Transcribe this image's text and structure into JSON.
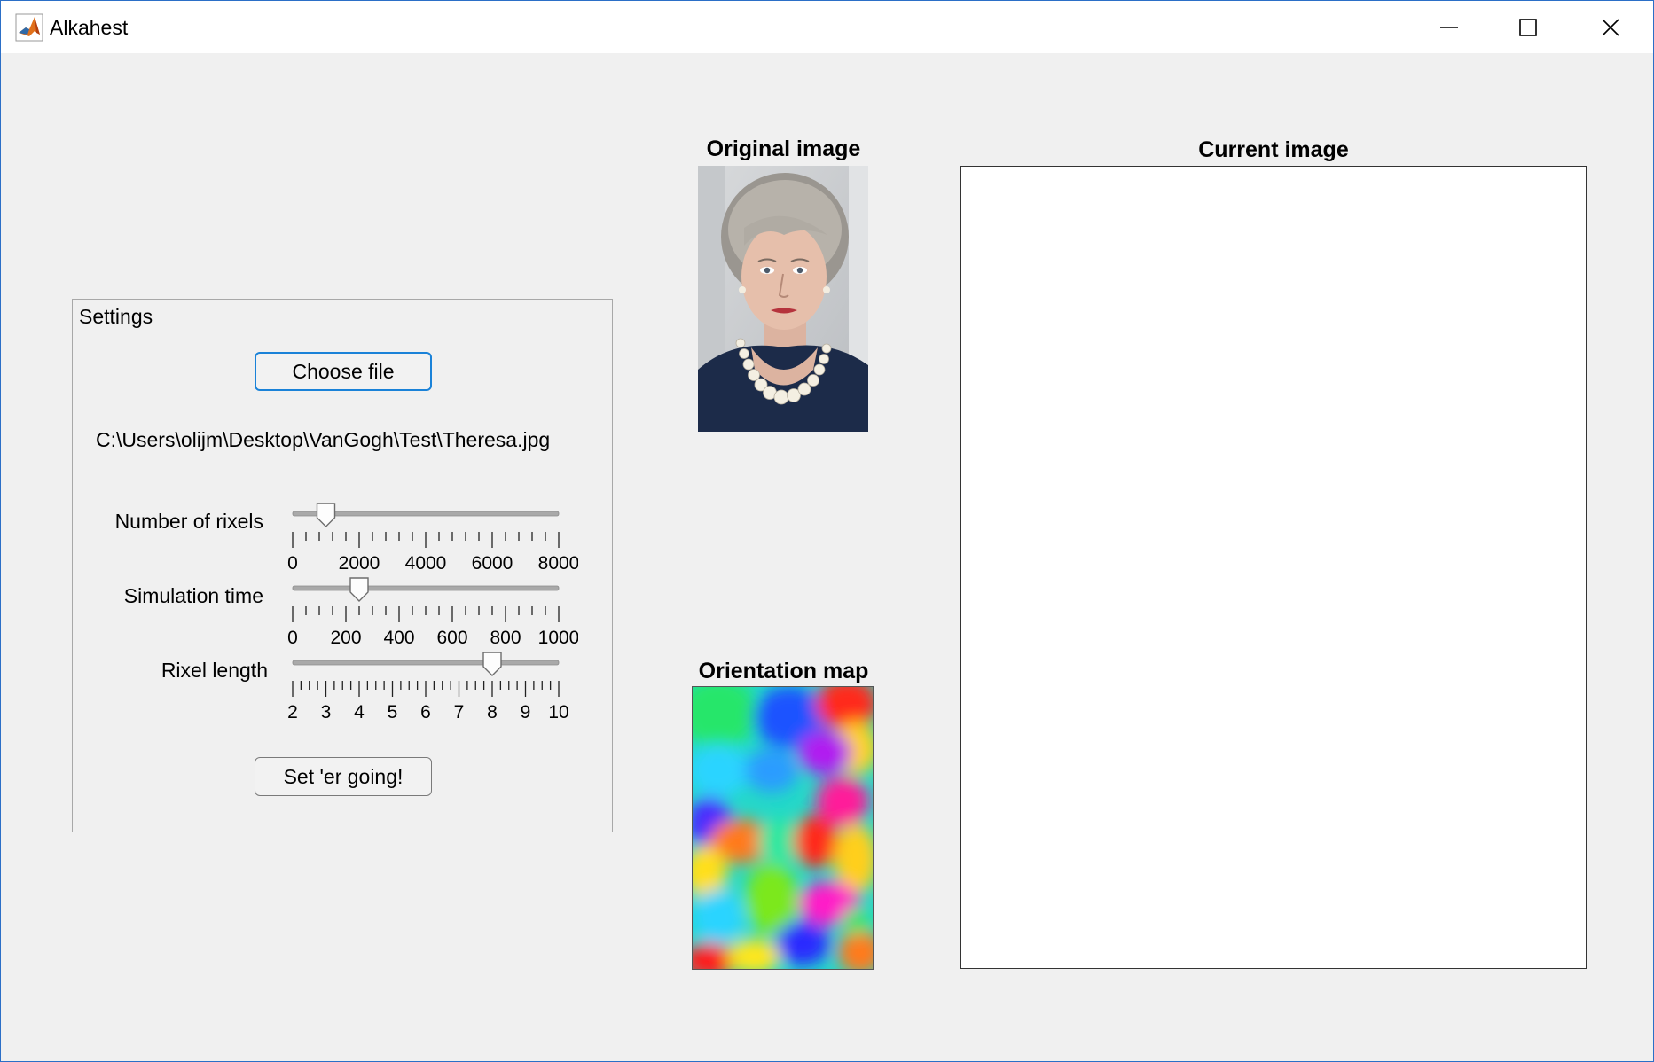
{
  "window": {
    "title": "Alkahest",
    "controls": [
      "minimize",
      "maximize",
      "close"
    ]
  },
  "settings": {
    "title": "Settings",
    "choose_file_label": "Choose file",
    "file_path": "C:\\Users\\olijm\\Desktop\\VanGogh\\Test\\Theresa.jpg",
    "run_label": "Set 'er going!",
    "sliders": [
      {
        "label": "Number of rixels",
        "min": 0,
        "max": 8000,
        "value": 1000,
        "tick_labels": [
          "0",
          "2000",
          "4000",
          "6000",
          "8000"
        ]
      },
      {
        "label": "Simulation time",
        "min": 0,
        "max": 1000,
        "value": 250,
        "tick_labels": [
          "0",
          "200",
          "400",
          "600",
          "800",
          "1000"
        ]
      },
      {
        "label": "Rixel length",
        "min": 2,
        "max": 10,
        "value": 8,
        "tick_labels": [
          "2",
          "3",
          "4",
          "5",
          "6",
          "7",
          "8",
          "9",
          "10"
        ]
      }
    ]
  },
  "axes": {
    "original_title": "Original image",
    "orientation_title": "Orientation map",
    "current_title": "Current image"
  },
  "colors": {
    "accent": "#1a82d8",
    "window_border": "#2b6fc7",
    "background": "#f0f0f0"
  },
  "icons": [
    "matlab-logo-icon",
    "minimize-icon",
    "maximize-icon",
    "close-icon"
  ]
}
